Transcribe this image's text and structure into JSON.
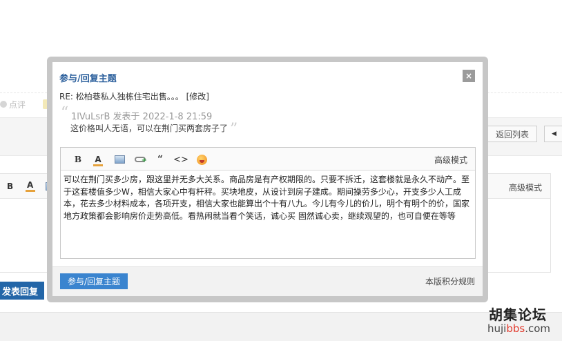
{
  "background": {
    "rate_label": "点评",
    "back_to_list": "返回列表",
    "editor_advanced": "高级模式",
    "editor_bold": "B",
    "editor_color": "A",
    "submit_label": "发表回复",
    "prev_icon": "◀"
  },
  "watermark": {
    "title": "胡集论坛",
    "url_prefix": "huji",
    "url_highlight": "bbs",
    "url_suffix": ".com"
  },
  "dialog": {
    "title": "参与/回复主题",
    "close_icon": "×",
    "subject": "RE: 松柏巷私人独栋住宅出售。。。 [修改]",
    "quote": {
      "open_mark": "“",
      "author_line": "1lVuLsrB 发表于 2022-1-8 21:59",
      "text": "这价格叫人无语，可以在荆门买两套房子了",
      "close_mark": "”"
    },
    "toolbar": {
      "bold": "B",
      "color": "A",
      "quote": "“",
      "code": "<>",
      "advanced": "高级模式"
    },
    "content": "可以在荆门买多少房，跟这里并无多大关系。商品房是有产权期限的。只要不拆迁，这套楼就是永久不动产。至于这套楼值多少W，相信大家心中有杆秤。买块地皮，从设计到房子建成。期间操劳多少心，开支多少人工成本，花去多少材料成本，各项开支，相信大家也能算出个十有八九。今儿有今儿的价儿，明个有明个的价，国家地方政策都会影响房价走势高低。看热闹就当看个笑话，诚心买 固然诚心卖，继续观望的，也可自便在等等",
    "submit_label": "参与/回复主题",
    "rules_link": "本版积分规则"
  }
}
